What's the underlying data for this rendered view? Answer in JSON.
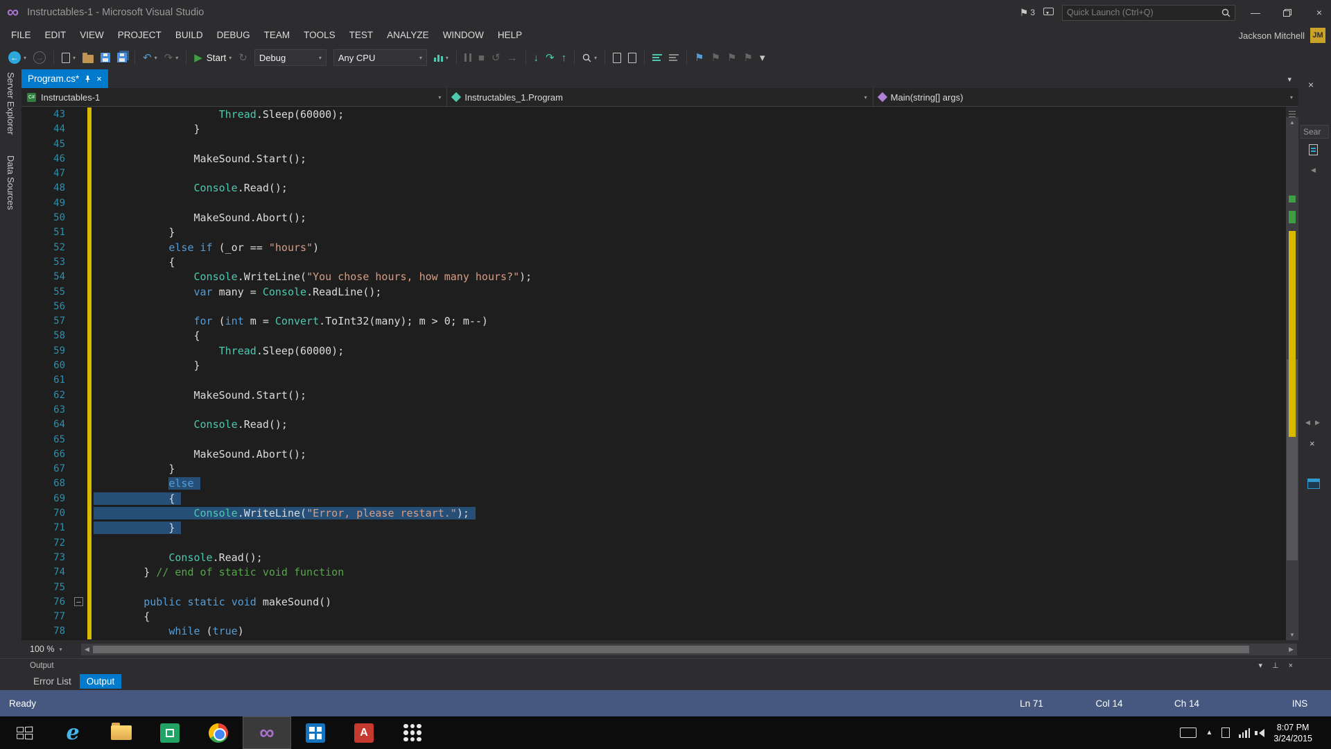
{
  "title_bar": {
    "title": "Instructables-1 - Microsoft Visual Studio",
    "notifications_count": "3",
    "quick_launch_placeholder": "Quick Launch (Ctrl+Q)"
  },
  "menu_bar": {
    "items": [
      "FILE",
      "EDIT",
      "VIEW",
      "PROJECT",
      "BUILD",
      "DEBUG",
      "TEAM",
      "TOOLS",
      "TEST",
      "ANALYZE",
      "WINDOW",
      "HELP"
    ],
    "user_name": "Jackson Mitchell",
    "user_initials": "JM"
  },
  "toolbar": {
    "start_label": "Start",
    "config_value": "Debug",
    "platform_value": "Any CPU"
  },
  "tabs": {
    "active_label": "Program.cs*"
  },
  "breadcrumb": {
    "project": "Instructables-1",
    "type": "Instructables_1.Program",
    "member": "Main(string[] args)"
  },
  "left_rail": {
    "items": [
      "Server Explorer",
      "Data Sources"
    ]
  },
  "right_rail": {
    "search_text": "Sear"
  },
  "editor": {
    "zoom": "100 %",
    "lines": [
      {
        "n": 43,
        "indent": 20,
        "tokens": [
          [
            "ty",
            "Thread"
          ],
          [
            "pl",
            ".Sleep(60000);"
          ]
        ]
      },
      {
        "n": 44,
        "indent": 16,
        "tokens": [
          [
            "pl",
            "}"
          ]
        ]
      },
      {
        "n": 45,
        "indent": 0,
        "tokens": []
      },
      {
        "n": 46,
        "indent": 16,
        "tokens": [
          [
            "pl",
            "MakeSound.Start();"
          ]
        ]
      },
      {
        "n": 47,
        "indent": 0,
        "tokens": []
      },
      {
        "n": 48,
        "indent": 16,
        "tokens": [
          [
            "ty",
            "Console"
          ],
          [
            "pl",
            ".Read();"
          ]
        ]
      },
      {
        "n": 49,
        "indent": 0,
        "tokens": []
      },
      {
        "n": 50,
        "indent": 16,
        "tokens": [
          [
            "pl",
            "MakeSound.Abort();"
          ]
        ]
      },
      {
        "n": 51,
        "indent": 12,
        "tokens": [
          [
            "pl",
            "}"
          ]
        ]
      },
      {
        "n": 52,
        "indent": 12,
        "tokens": [
          [
            "kw",
            "else"
          ],
          [
            "pl",
            " "
          ],
          [
            "kw",
            "if"
          ],
          [
            "pl",
            " (_or == "
          ],
          [
            "st",
            "\"hours\""
          ],
          [
            "pl",
            ")"
          ]
        ]
      },
      {
        "n": 53,
        "indent": 12,
        "tokens": [
          [
            "pl",
            "{"
          ]
        ]
      },
      {
        "n": 54,
        "indent": 16,
        "tokens": [
          [
            "ty",
            "Console"
          ],
          [
            "pl",
            ".WriteLine("
          ],
          [
            "st",
            "\"You chose hours, how many hours?\""
          ],
          [
            "pl",
            ");"
          ]
        ]
      },
      {
        "n": 55,
        "indent": 16,
        "tokens": [
          [
            "kw",
            "var"
          ],
          [
            "pl",
            " many = "
          ],
          [
            "ty",
            "Console"
          ],
          [
            "pl",
            ".ReadLine();"
          ]
        ]
      },
      {
        "n": 56,
        "indent": 0,
        "tokens": []
      },
      {
        "n": 57,
        "indent": 16,
        "tokens": [
          [
            "kw",
            "for"
          ],
          [
            "pl",
            " ("
          ],
          [
            "kw",
            "int"
          ],
          [
            "pl",
            " m = "
          ],
          [
            "ty",
            "Convert"
          ],
          [
            "pl",
            ".ToInt32(many); m > 0; m--)"
          ]
        ]
      },
      {
        "n": 58,
        "indent": 16,
        "tokens": [
          [
            "pl",
            "{"
          ]
        ]
      },
      {
        "n": 59,
        "indent": 20,
        "tokens": [
          [
            "ty",
            "Thread"
          ],
          [
            "pl",
            ".Sleep(60000);"
          ]
        ]
      },
      {
        "n": 60,
        "indent": 16,
        "tokens": [
          [
            "pl",
            "}"
          ]
        ]
      },
      {
        "n": 61,
        "indent": 0,
        "tokens": []
      },
      {
        "n": 62,
        "indent": 16,
        "tokens": [
          [
            "pl",
            "MakeSound.Start();"
          ]
        ]
      },
      {
        "n": 63,
        "indent": 0,
        "tokens": []
      },
      {
        "n": 64,
        "indent": 16,
        "tokens": [
          [
            "ty",
            "Console"
          ],
          [
            "pl",
            ".Read();"
          ]
        ]
      },
      {
        "n": 65,
        "indent": 0,
        "tokens": []
      },
      {
        "n": 66,
        "indent": 16,
        "tokens": [
          [
            "pl",
            "MakeSound.Abort();"
          ]
        ]
      },
      {
        "n": 67,
        "indent": 12,
        "tokens": [
          [
            "pl",
            "}"
          ]
        ]
      },
      {
        "n": 68,
        "indent": 12,
        "sel": "tokens",
        "tokens": [
          [
            "kw",
            "else"
          ]
        ]
      },
      {
        "n": 69,
        "indent": 12,
        "sel": "full",
        "tokens": [
          [
            "pl",
            "{"
          ]
        ]
      },
      {
        "n": 70,
        "indent": 16,
        "sel": "full",
        "tokens": [
          [
            "ty",
            "Console"
          ],
          [
            "pl",
            ".WriteLine("
          ],
          [
            "st",
            "\"Error, please restart.\""
          ],
          [
            "pl",
            ");"
          ]
        ]
      },
      {
        "n": 71,
        "indent": 12,
        "sel": "full",
        "tokens": [
          [
            "pl",
            "}"
          ]
        ]
      },
      {
        "n": 72,
        "indent": 0,
        "tokens": []
      },
      {
        "n": 73,
        "indent": 12,
        "tokens": [
          [
            "ty",
            "Console"
          ],
          [
            "pl",
            ".Read();"
          ]
        ]
      },
      {
        "n": 74,
        "indent": 8,
        "tokens": [
          [
            "pl",
            "} "
          ],
          [
            "cm",
            "// end of static void function"
          ]
        ]
      },
      {
        "n": 75,
        "indent": 0,
        "tokens": []
      },
      {
        "n": 76,
        "indent": 8,
        "fold": true,
        "tokens": [
          [
            "kw",
            "public"
          ],
          [
            "pl",
            " "
          ],
          [
            "kw",
            "static"
          ],
          [
            "pl",
            " "
          ],
          [
            "kw",
            "void"
          ],
          [
            "pl",
            " makeSound()"
          ]
        ]
      },
      {
        "n": 77,
        "indent": 8,
        "tokens": [
          [
            "pl",
            "{"
          ]
        ]
      },
      {
        "n": 78,
        "indent": 12,
        "tokens": [
          [
            "kw",
            "while"
          ],
          [
            "pl",
            " ("
          ],
          [
            "kw",
            "true"
          ],
          [
            "pl",
            ")"
          ]
        ]
      }
    ]
  },
  "bottom_panel": {
    "title": "Output",
    "tabs": [
      {
        "label": "Error List",
        "active": false
      },
      {
        "label": "Output",
        "active": true
      }
    ]
  },
  "status_bar": {
    "ready": "Ready",
    "ln": "Ln 71",
    "col": "Col 14",
    "ch": "Ch 14",
    "mode": "INS"
  },
  "taskbar": {
    "time": "8:07 PM",
    "date": "3/24/2015"
  },
  "colors": {
    "accent": "#007ACC",
    "selection": "#264F78",
    "keyword": "#569CD6",
    "type": "#4EC9B0",
    "string": "#D69D85",
    "comment": "#57A64A",
    "change_bar": "#D7BA00",
    "status_bar": "#46587F"
  }
}
